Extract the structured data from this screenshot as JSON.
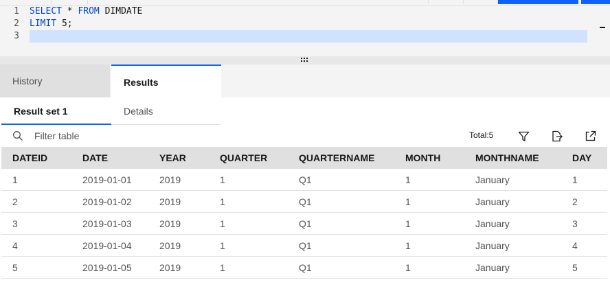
{
  "editor": {
    "line_numbers": [
      "1",
      "2",
      "3"
    ],
    "lines": [
      {
        "kw1": "SELECT",
        "mid": " * ",
        "kw2": "FROM",
        "rest": " DIMDATE"
      },
      {
        "kw1": "LIMIT",
        "rest": " 5;"
      },
      {
        "text": ""
      }
    ]
  },
  "main_tabs": {
    "history": "History",
    "results": "Results"
  },
  "sub_tabs": {
    "result_set": "Result set 1",
    "details": "Details"
  },
  "toolbar": {
    "filter_placeholder": "Filter table",
    "total": "Total:5",
    "icons": [
      "search-icon",
      "filter-icon",
      "export-icon",
      "open-new-window-icon"
    ]
  },
  "colors": {
    "accent": "#0f62fe",
    "header_bg": "#e0e0e0",
    "editor_bg": "#f4f4f4",
    "selection": "#d0e2ff"
  },
  "table": {
    "columns": [
      "DATEID",
      "DATE",
      "YEAR",
      "QUARTER",
      "QUARTERNAME",
      "MONTH",
      "MONTHNAME",
      "DAY"
    ],
    "rows": [
      [
        "1",
        "2019-01-01",
        "2019",
        "1",
        "Q1",
        "1",
        "January",
        "1"
      ],
      [
        "2",
        "2019-01-02",
        "2019",
        "1",
        "Q1",
        "1",
        "January",
        "2"
      ],
      [
        "3",
        "2019-01-03",
        "2019",
        "1",
        "Q1",
        "1",
        "January",
        "3"
      ],
      [
        "4",
        "2019-01-04",
        "2019",
        "1",
        "Q1",
        "1",
        "January",
        "4"
      ],
      [
        "5",
        "2019-01-05",
        "2019",
        "1",
        "Q1",
        "1",
        "January",
        "5"
      ]
    ]
  }
}
